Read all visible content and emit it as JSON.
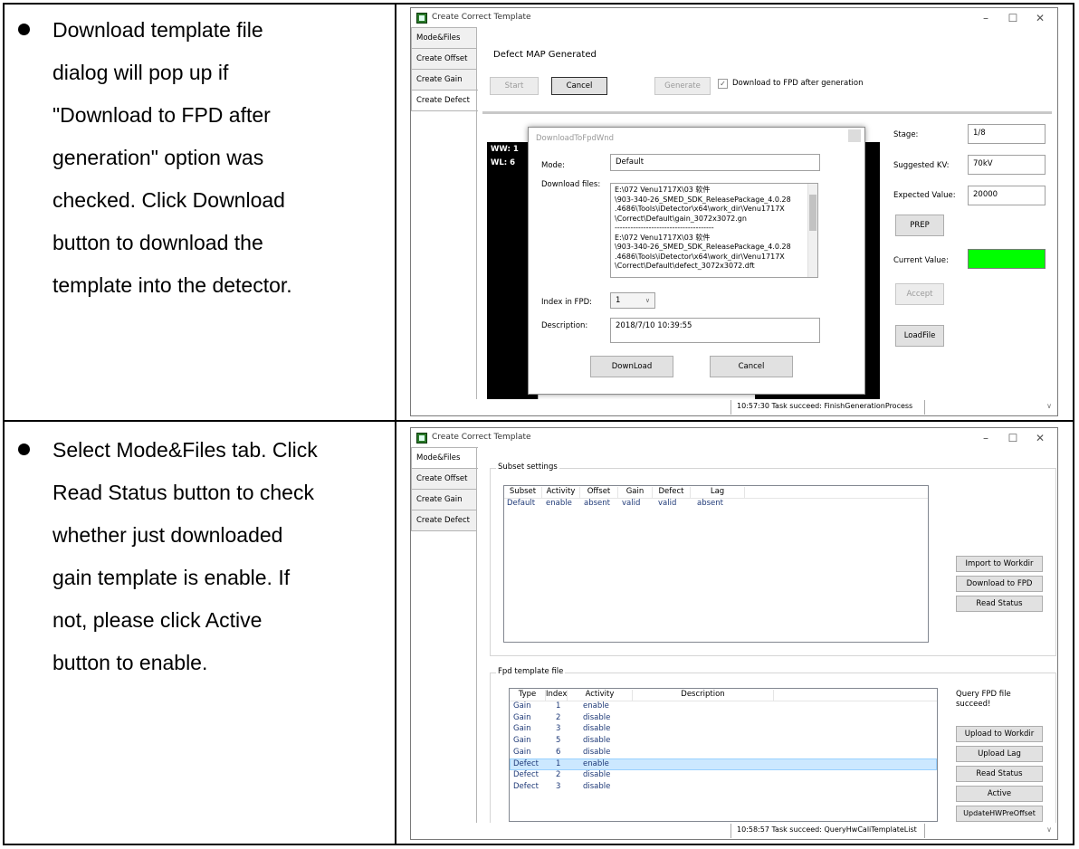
{
  "row1": {
    "description_lines": [
      "Download template file",
      "dialog will pop up if",
      "\"Download to FPD after",
      "generation\" option was",
      "checked. Click Download",
      "button to download the",
      "template into the detector."
    ],
    "window": {
      "title": "Create Correct Template",
      "tabs": [
        "Mode&Files",
        "Create Offset",
        "Create Gain",
        "Create Defect"
      ],
      "selected_tab": "Create Defect",
      "heading": "Defect MAP Generated",
      "start_button": "Start",
      "cancel_button": "Cancel",
      "generate_button": "Generate",
      "download_checkbox_label": "Download to FPD after generation",
      "ww_label": "WW:",
      "ww_value": "1",
      "wl_label": "WL:",
      "wl_value": "6",
      "stage_label": "Stage:",
      "stage_value": "1/8",
      "suggested_kv_label": "Suggested KV:",
      "suggested_kv_value": "70kV",
      "expected_value_label": "Expected Value:",
      "expected_value": "20000",
      "prep_button": "PREP",
      "current_value_label": "Current Value:",
      "current_value_color": "#00ff00",
      "accept_button": "Accept",
      "loadfile_button": "LoadFile",
      "status": "10:57:30 Task succeed: FinishGenerationProcess"
    },
    "dialog": {
      "title": "DownloadToFpdWnd",
      "mode_label": "Mode:",
      "mode_value": "Default",
      "download_files_label": "Download files:",
      "files_lines": [
        "E:\\072 Venu1717X\\03 软件",
        "\\903-340-26_SMED_SDK_ReleasePackage_4.0.28",
        ".4686\\Tools\\iDetector\\x64\\work_dir\\Venu1717X",
        "\\Correct\\Default\\gain_3072x3072.gn",
        "--------------------------------------",
        "E:\\072 Venu1717X\\03 软件",
        "\\903-340-26_SMED_SDK_ReleasePackage_4.0.28",
        ".4686\\Tools\\iDetector\\x64\\work_dir\\Venu1717X",
        "\\Correct\\Default\\defect_3072x3072.dft"
      ],
      "index_label": "Index in FPD:",
      "index_value": "1",
      "description_label": "Description:",
      "description_value": "2018/7/10 10:39:55",
      "download_button": "DownLoad",
      "cancel_button": "Cancel"
    }
  },
  "row2": {
    "description_lines": [
      "Select Mode&Files tab. Click",
      "Read Status button to check",
      "whether just downloaded",
      "gain template is enable. If",
      "not, please click Active",
      "button to enable."
    ],
    "window": {
      "title": "Create Correct Template",
      "tabs": [
        "Mode&Files",
        "Create Offset",
        "Create Gain",
        "Create Defect"
      ],
      "selected_tab": "Mode&Files",
      "subset_group_title": "Subset settings",
      "subset_columns": [
        "Subset",
        "Activity",
        "Offset",
        "Gain",
        "Defect",
        "Lag"
      ],
      "subset_rows": [
        [
          "Default",
          "enable",
          "absent",
          "valid",
          "valid",
          "absent"
        ]
      ],
      "import_button": "Import to Workdir",
      "download_fpd_button": "Download to FPD",
      "read_status_button": "Read Status",
      "fpd_group_title": "Fpd template file",
      "fpd_columns": [
        "Type",
        "Index",
        "Activity",
        "Description"
      ],
      "fpd_rows": [
        [
          "Gain",
          "1",
          "enable"
        ],
        [
          "Gain",
          "2",
          "disable"
        ],
        [
          "Gain",
          "3",
          "disable"
        ],
        [
          "Gain",
          "5",
          "disable"
        ],
        [
          "Gain",
          "6",
          "disable"
        ],
        [
          "Defect",
          "1",
          "enable"
        ],
        [
          "Defect",
          "2",
          "disable"
        ],
        [
          "Defect",
          "3",
          "disable"
        ]
      ],
      "selected_fpd_row": 5,
      "query_msg": "Query FPD file succeed!",
      "upload_workdir_button": "Upload to Workdir",
      "upload_lag_button": "Upload Lag",
      "read_status_button2": "Read Status",
      "active_button": "Active",
      "update_button": "UpdateHWPreOffset",
      "status": "10:58:57 Task succeed: QueryHwCaliTemplateList"
    }
  }
}
